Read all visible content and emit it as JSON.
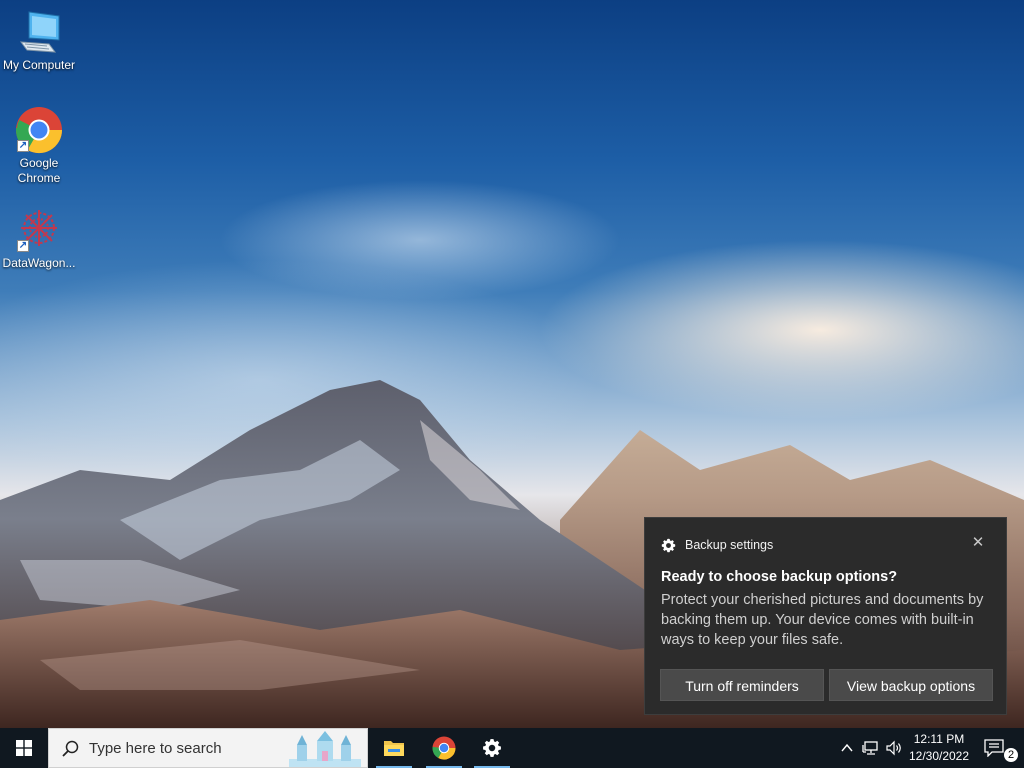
{
  "desktop": {
    "icons": [
      {
        "label": "My Computer",
        "icon": "computer-icon"
      },
      {
        "label": "Google Chrome",
        "icon": "chrome-icon"
      },
      {
        "label": "DataWagon...",
        "icon": "datawagon-icon"
      }
    ]
  },
  "toast": {
    "app_name": "Backup settings",
    "app_icon": "gear-icon",
    "title": "Ready to choose backup options?",
    "body": "Protect your cherished pictures and documents by backing them up. Your device comes with built-in ways to keep your files safe.",
    "buttons": {
      "turn_off": "Turn off reminders",
      "view": "View backup options"
    },
    "close_icon": "close-icon"
  },
  "taskbar": {
    "search_placeholder": "Type here to search",
    "pinned_apps": [
      "File Explorer",
      "Google Chrome",
      "Settings"
    ],
    "tray": {
      "time": "12:11 PM",
      "date": "12/30/2022",
      "notification_count": "2"
    }
  },
  "colors": {
    "taskbar": "#101820",
    "toast_bg": "#2b2b2b",
    "toast_button": "#4a4a4a",
    "active_underline": "#76b9ed"
  }
}
